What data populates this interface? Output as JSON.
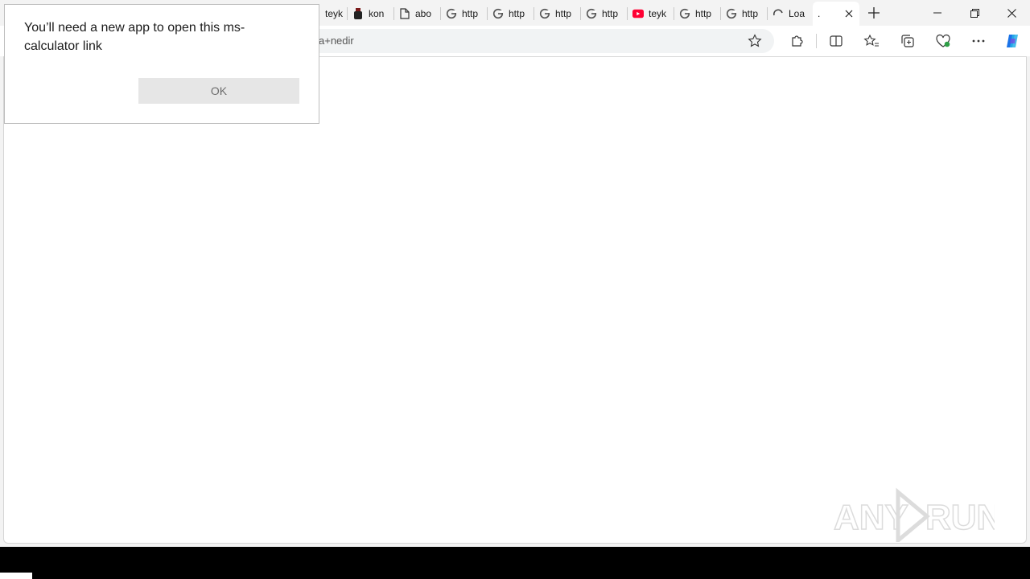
{
  "dialog": {
    "message": "You’ll need a new app to open this ms-calculator link",
    "ok_label": "OK"
  },
  "tabs": [
    {
      "title": "teyk",
      "icon": "page-icon"
    },
    {
      "title": "kon",
      "icon": "ink-bottle-icon"
    },
    {
      "title": "abo",
      "icon": "document-icon"
    },
    {
      "title": "http",
      "icon": "google-icon"
    },
    {
      "title": "http",
      "icon": "google-icon"
    },
    {
      "title": "http",
      "icon": "google-icon"
    },
    {
      "title": "http",
      "icon": "google-icon"
    },
    {
      "title": "teyk",
      "icon": "youtube-icon"
    },
    {
      "title": "http",
      "icon": "google-icon"
    },
    {
      "title": "http",
      "icon": "google-icon"
    },
    {
      "title": "Loa",
      "icon": "loading-spinner-icon"
    },
    {
      "title": ".",
      "icon": ""
    }
  ],
  "address": {
    "url_fragment": "a+nedir"
  },
  "watermark": {
    "text_left": "ANY",
    "text_right": "RUN"
  },
  "colors": {
    "copilot": "#1a73e8",
    "youtube": "#ff0033",
    "dialog_button": "#e6e6e6"
  }
}
